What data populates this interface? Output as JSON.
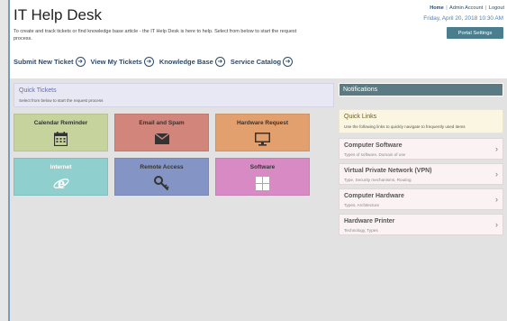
{
  "header": {
    "title": "IT Help Desk",
    "description": "To create and track tickets or find knowledge base article - the IT Help Desk is here to help. Select from below to start the request process.",
    "links": {
      "home": "Home",
      "admin": "Admin Account",
      "logout": "Logout",
      "sep": "|"
    },
    "datetime": "Friday, April 20, 2018 10:30 AM",
    "portal_settings": "Portal Settings"
  },
  "actions": [
    {
      "label": "Submit New Ticket",
      "icon": "arrow-circle-right-icon"
    },
    {
      "label": "View My Tickets",
      "icon": "arrow-circle-right-icon"
    },
    {
      "label": "Knowledge Base",
      "icon": "arrow-circle-right-icon"
    },
    {
      "label": "Service Catalog",
      "icon": "arrow-circle-right-icon"
    }
  ],
  "quick_tickets": {
    "title": "Quick Tickets",
    "subtitle": "Select from below to start the request process",
    "tiles": [
      {
        "label": "Calendar Reminder",
        "icon": "calendar-icon",
        "color": "#c6d39d"
      },
      {
        "label": "Email and Spam",
        "icon": "envelope-icon",
        "color": "#d2857a"
      },
      {
        "label": "Hardware Request",
        "icon": "monitor-icon",
        "color": "#e2a06e"
      },
      {
        "label": "Internet",
        "icon": "internet-explorer-icon",
        "color": "#8fd0cf"
      },
      {
        "label": "Remote Access",
        "icon": "key-icon",
        "color": "#8494c4"
      },
      {
        "label": "Software",
        "icon": "windows-icon",
        "color": "#d88ac4"
      }
    ]
  },
  "notifications": {
    "title": "Notifications"
  },
  "quick_links": {
    "title": "Quick Links",
    "subtitle": "Use the following links to quickly navigate to frequently used items",
    "items": [
      {
        "title": "Computer Software",
        "subtitle": "Types of software, Domain of use"
      },
      {
        "title": "Virtual Private Network (VPN)",
        "subtitle": "Type, Security mechanisms, Routing"
      },
      {
        "title": "Computer Hardware",
        "subtitle": "Types, Architecture"
      },
      {
        "title": "Hardware Printer",
        "subtitle": "Technology, Types"
      }
    ],
    "chevron": "›"
  }
}
